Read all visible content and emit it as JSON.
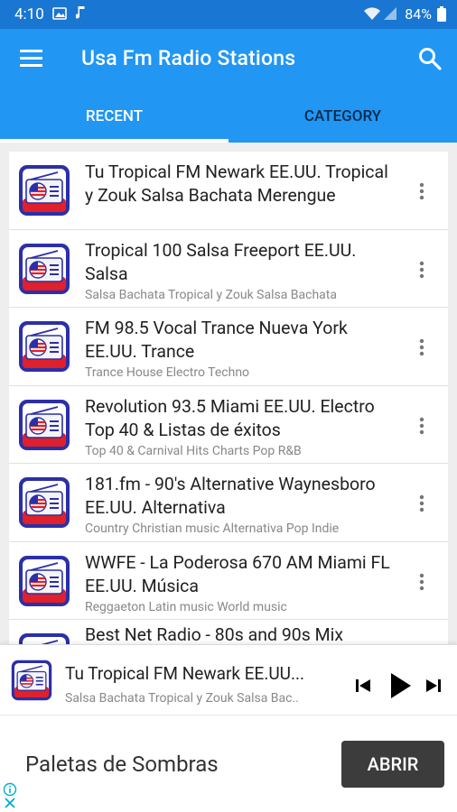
{
  "status_bar": {
    "time": "4:10",
    "battery": "84%"
  },
  "app_bar": {
    "title": "Usa Fm Radio Stations"
  },
  "tabs": [
    {
      "label": "RECENT",
      "selected": true
    },
    {
      "label": "CATEGORY",
      "selected": false
    }
  ],
  "stations": [
    {
      "title": "Tu Tropical FM Newark EE.UU. Tropical y Zouk Salsa Bachata Merengue",
      "subtitle": ""
    },
    {
      "title": "Tropical 100 Salsa Freeport EE.UU. Salsa",
      "subtitle": "Salsa Bachata Tropical y Zouk Salsa Bachata"
    },
    {
      "title": "FM 98.5 Vocal Trance Nueva York EE.UU. Trance",
      "subtitle": "Trance House Electro Techno"
    },
    {
      "title": "Revolution 93.5 Miami EE.UU. Electro Top 40 & Listas de éxitos",
      "subtitle": "Top 40 & Carnival Hits Charts Pop R&B"
    },
    {
      "title": "181.fm - 90's Alternative Waynesboro EE.UU. Alternativa",
      "subtitle": "Country Christian music Alternativa Pop Indie"
    },
    {
      "title": "WWFE - La Poderosa 670 AM Miami FL EE.UU. Música",
      "subtitle": "Reggaeton Latin music World music"
    },
    {
      "title": "Best Net Radio - 80s and 90s Mix",
      "subtitle": ""
    }
  ],
  "player": {
    "title": "Tu Tropical FM Newark EE.UU...",
    "subtitle": "Salsa Bachata Tropical y Zouk Salsa Bac.."
  },
  "ad": {
    "text": "Paletas de Sombras",
    "button": "ABRIR"
  },
  "colors": {
    "status_bar": "#1976d2",
    "app_bar": "#2196f3",
    "tab_inactive_text": "#0d2a4a",
    "ad_button": "#3c3c3c"
  }
}
